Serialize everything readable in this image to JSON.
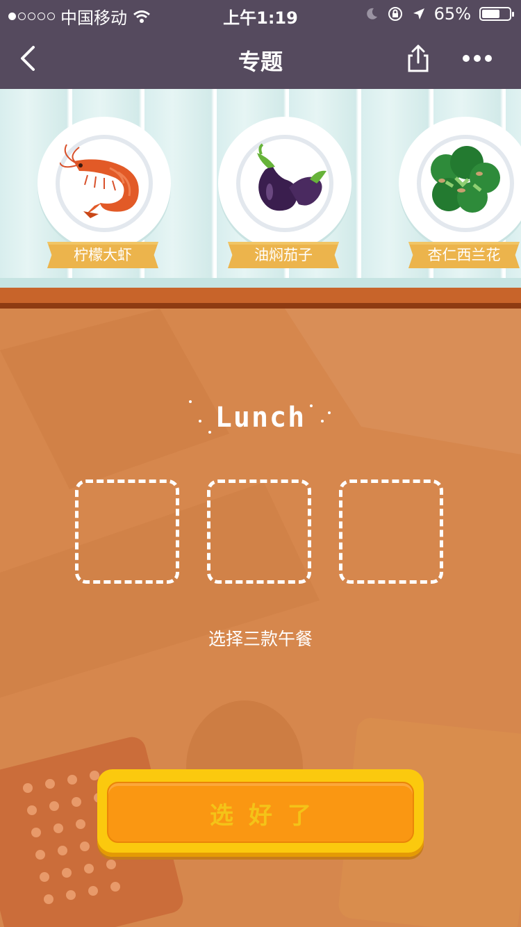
{
  "status_bar": {
    "carrier": "中国移动",
    "time": "上午1:19",
    "battery": "65%",
    "battery_level": 0.65,
    "signal_bars_filled": 1,
    "signal_bars_total": 5,
    "icons": [
      "wifi-icon",
      "moon-icon",
      "rotation-lock-icon",
      "location-arrow-icon",
      "battery-icon"
    ]
  },
  "nav": {
    "title": "专题",
    "icons": [
      "back-chevron-icon",
      "share-icon",
      "more-dots-icon"
    ]
  },
  "foods": [
    {
      "label": "柠檬大虾",
      "icon": "shrimp-icon"
    },
    {
      "label": "油焖茄子",
      "icon": "eggplant-icon"
    },
    {
      "label": "杏仁西兰花",
      "icon": "broccoli-icon"
    }
  ],
  "main": {
    "heading": "Lunch",
    "slot_count": 3,
    "hint": "选择三款午餐",
    "confirm_label": "选好了"
  },
  "colors": {
    "nav_bg": "#554a5e",
    "main_bg": "#d6874d",
    "shelf": "#c8642a",
    "ribbon": "#ecb44c",
    "button_outer": "#fbc90e",
    "button_inner": "#fa9712"
  }
}
